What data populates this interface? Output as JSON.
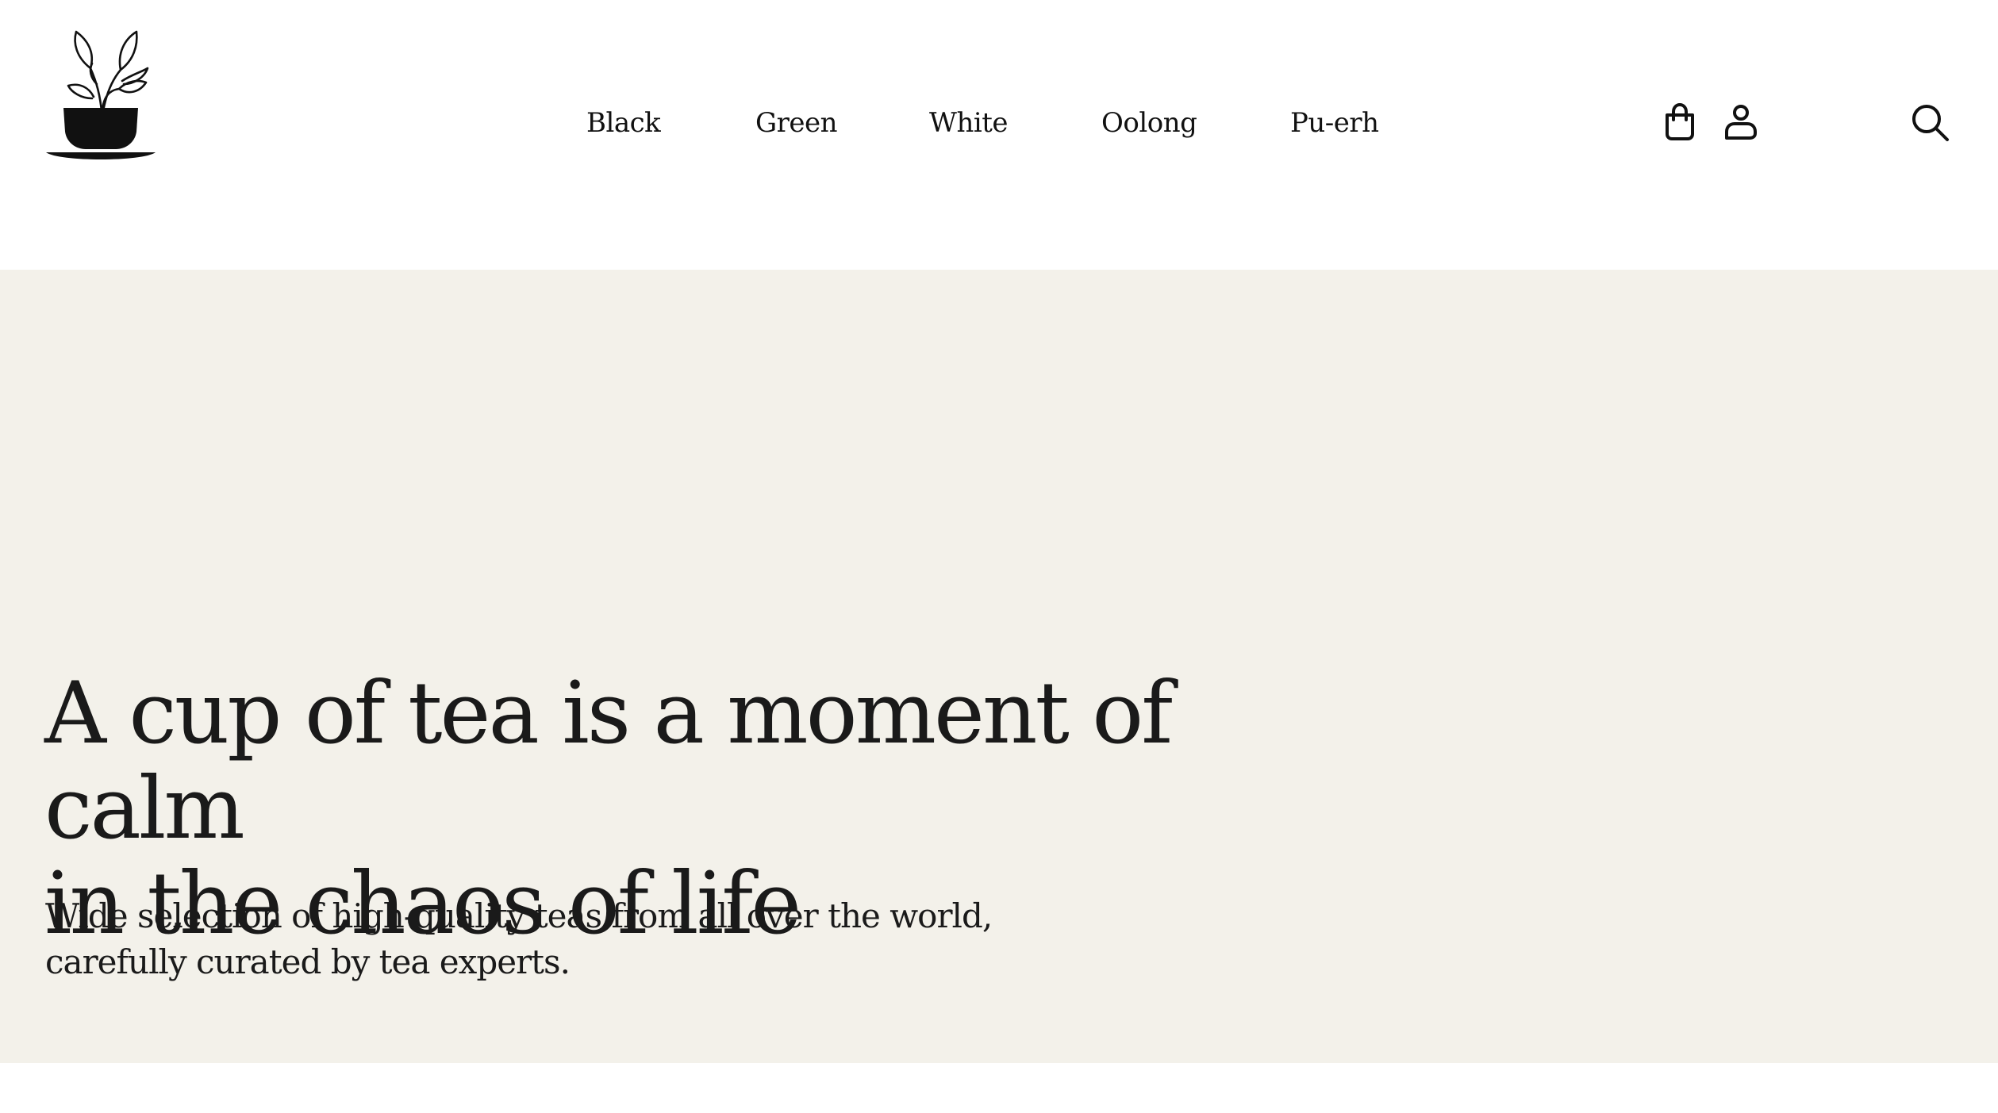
{
  "brand": {
    "logo_icon": "tea-cup-with-leaves-icon"
  },
  "nav": {
    "items": [
      {
        "label": "Black"
      },
      {
        "label": "Green"
      },
      {
        "label": "White"
      },
      {
        "label": "Oolong"
      },
      {
        "label": "Pu-erh"
      }
    ]
  },
  "actions": {
    "cart_icon": "shopping-bag-icon",
    "account_icon": "user-icon",
    "search_icon": "search-icon"
  },
  "hero": {
    "title_line1": "A cup of tea is a moment of calm",
    "title_line2": "in the chaos of life",
    "subtitle_line1": "Wide selection of high-quality teas from all over the world,",
    "subtitle_line2": "carefully curated by tea experts.",
    "background_color": "#f3f1ea"
  }
}
